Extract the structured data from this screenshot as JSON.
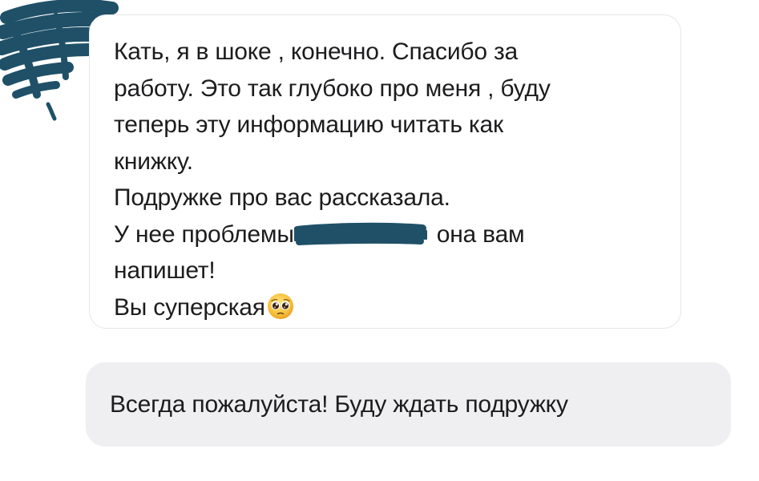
{
  "colors": {
    "redaction": "#1f5068",
    "incoming_border": "#e6e6e9",
    "outgoing_background": "#efeff1",
    "text": "#1c1c1e"
  },
  "incoming_message": {
    "lines": [
      "Кать, я в шоке , конечно. Спасибо за",
      "работу. Это так глубоко про меня , буду",
      "теперь эту информацию читать как",
      "книжку.",
      "Подружке про вас рассказала.",
      "У нее проблемы",
      "она вам",
      "напишет!",
      "Вы суперская"
    ],
    "emoji": "pleading-face-icon"
  },
  "outgoing_message": {
    "text": "Всегда пожалуйста! Буду ждать подружку"
  }
}
